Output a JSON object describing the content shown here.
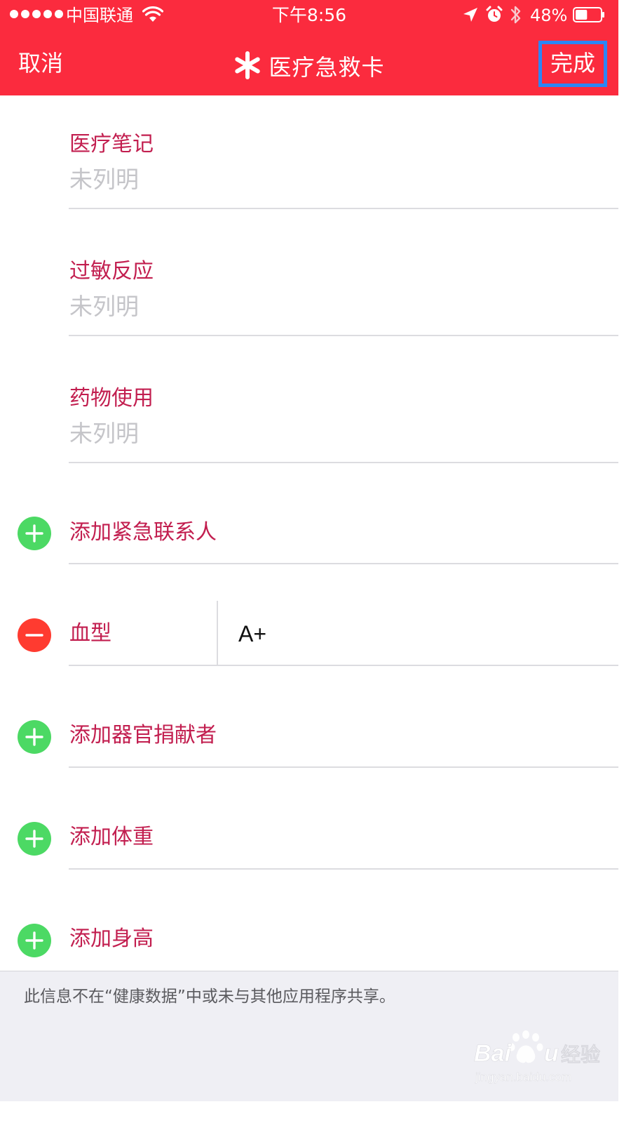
{
  "status_bar": {
    "carrier": "中国联通",
    "time": "下午8:56",
    "battery": "48%",
    "battery_level": 0.48
  },
  "nav": {
    "cancel_label": "取消",
    "title": "医疗急救卡",
    "done_label": "完成"
  },
  "fields": {
    "medical_notes": {
      "label": "医疗笔记",
      "value": "未列明"
    },
    "allergies": {
      "label": "过敏反应",
      "value": "未列明"
    },
    "medications": {
      "label": "药物使用",
      "value": "未列明"
    }
  },
  "actions": {
    "add_emergency_contact": "添加紧急联系人",
    "add_organ_donor": "添加器官捐献者",
    "add_weight": "添加体重",
    "add_height": "添加身高"
  },
  "blood_type": {
    "label": "血型",
    "value": "A+"
  },
  "footer": {
    "note": "此信息不在“健康数据”中或未与其他应用程序共享。"
  },
  "watermark": {
    "brand": "Baidu经验",
    "url": "jingyan.baidu.com"
  },
  "colors": {
    "header_bg": "#fb2b3e",
    "label_red": "#c21e4f",
    "placeholder_gray": "#c5c5c9",
    "add_green": "#4cd964",
    "remove_red": "#ff3b30",
    "highlight_blue": "#2b86f5",
    "footer_bg": "#efeff4"
  },
  "icons": {
    "title_icon": "asterisk-icon",
    "add_icon": "plus-circle-icon",
    "remove_icon": "minus-circle-icon"
  }
}
